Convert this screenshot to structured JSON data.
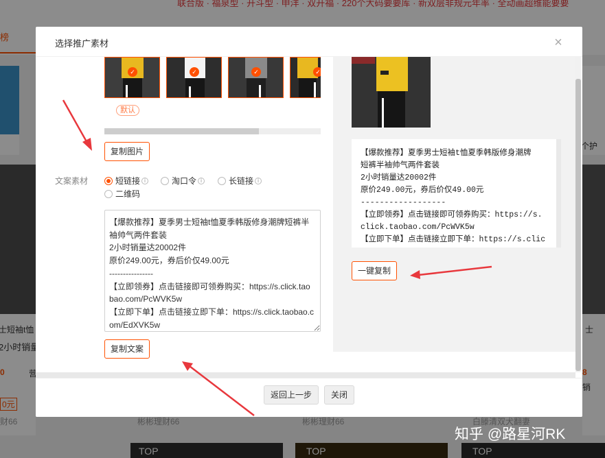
{
  "background": {
    "promo_text": "联合版 · 福泉型 · 开斗型 · 申洋 · 双开福 · 220个大码要要库 · 新双层非规元年率 · 全动画超维能要要",
    "active_tab": "榜",
    "left_card_lines": [
      "士短袖t恤",
      "2小时销量"
    ],
    "left_price": "0",
    "left_tag": "0元",
    "left_shop": "财66",
    "left_sold": "营",
    "mid_shop_1": "彬彬理财66",
    "mid_shop_2": "彬彬理财66",
    "right_shop": "白滕清双犬翻妻",
    "right_label_1": "个护",
    "right_label_2": "士",
    "right_price": "8",
    "right_sold": "销",
    "promo_badge_1": "TOP",
    "promo_badge_2": "TOP",
    "promo_badge_3": "TOP"
  },
  "watermark": "知乎 @路星河RK",
  "modal": {
    "title": "选择推广素材",
    "close_icon": "close-icon",
    "image_section": {
      "default_tag": "默认",
      "copy_image_label": "复制图片"
    },
    "copy_section": {
      "label": "文案素材",
      "options": [
        {
          "label": "短链接",
          "selected": true
        },
        {
          "label": "淘口令",
          "selected": false
        },
        {
          "label": "长链接",
          "selected": false
        },
        {
          "label": "二维码",
          "selected": false
        }
      ],
      "text_lines": [
        "【爆款推荐】夏季男士短袖t恤夏季韩版修身潮牌短裤半",
        "袖帅气两件套装",
        "2小时销量达20002件",
        "原价249.00元，券后价仅49.00元",
        "----------------",
        "【立即领券】点击链接即可领券购买：https://s.click.tao",
        "bao.com/PcWVK5w",
        "【立即下单】点击链接立即下单：https://s.click.taobao.c",
        "om/EdXVK5w"
      ],
      "copy_text_label": "复制文案"
    },
    "preview": {
      "lines": [
        "【爆款推荐】夏季男士短袖t恤夏季韩版修身潮牌",
        "短裤半袖帅气两件套装",
        "2小时销量达20002件",
        "原价249.00元，券后价仅49.00元",
        "------------------",
        "【立即领券】点击链接即可领券购买：https://s.",
        "click.taobao.com/PcWVK5w",
        "【立即下单】点击链接立即下单：https://s.clic"
      ],
      "one_click_copy_label": "一键复制"
    },
    "footer": {
      "back_label": "返回上一步",
      "close_label": "关闭"
    }
  },
  "colors": {
    "accent": "#ff5000",
    "arrow": "#e8383d"
  }
}
